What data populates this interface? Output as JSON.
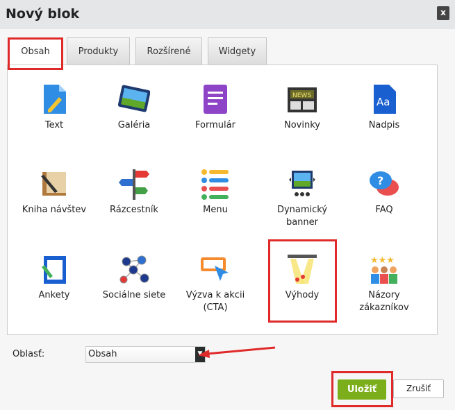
{
  "dialog": {
    "title": "Nový blok",
    "close_label": "x"
  },
  "tabs": [
    {
      "label": "Obsah",
      "active": true
    },
    {
      "label": "Produkty"
    },
    {
      "label": "Rozšírené"
    },
    {
      "label": "Widgety"
    }
  ],
  "blocks": [
    {
      "label": "Text",
      "icon": "text-document-icon"
    },
    {
      "label": "Galéria",
      "icon": "gallery-icon"
    },
    {
      "label": "Formulár",
      "icon": "form-icon"
    },
    {
      "label": "Novinky",
      "icon": "news-icon",
      "icon_text": "NEWS"
    },
    {
      "label": "Nadpis",
      "icon": "heading-icon",
      "icon_text": "Aa"
    },
    {
      "label": "Kniha návštev",
      "icon": "guestbook-icon"
    },
    {
      "label": "Rázcestník",
      "icon": "signpost-icon"
    },
    {
      "label": "Menu",
      "icon": "menu-icon"
    },
    {
      "label": "Dynamický banner",
      "icon": "banner-icon"
    },
    {
      "label": "FAQ",
      "icon": "faq-icon",
      "icon_text": "?"
    },
    {
      "label": "Ankety",
      "icon": "poll-icon"
    },
    {
      "label": "Sociálne siete",
      "icon": "social-network-icon"
    },
    {
      "label": "Výzva k akcii (CTA)",
      "icon": "cta-icon"
    },
    {
      "label": "Výhody",
      "icon": "benefits-spotlight-icon"
    },
    {
      "label": "Názory zákazníkov",
      "icon": "reviews-icon"
    }
  ],
  "area": {
    "label": "Oblasť:",
    "value": "Obsah"
  },
  "buttons": {
    "save": "Uložiť",
    "cancel": "Zrušiť"
  },
  "colors": {
    "save": "#7bae1a",
    "highlight": "#e02a2a"
  }
}
